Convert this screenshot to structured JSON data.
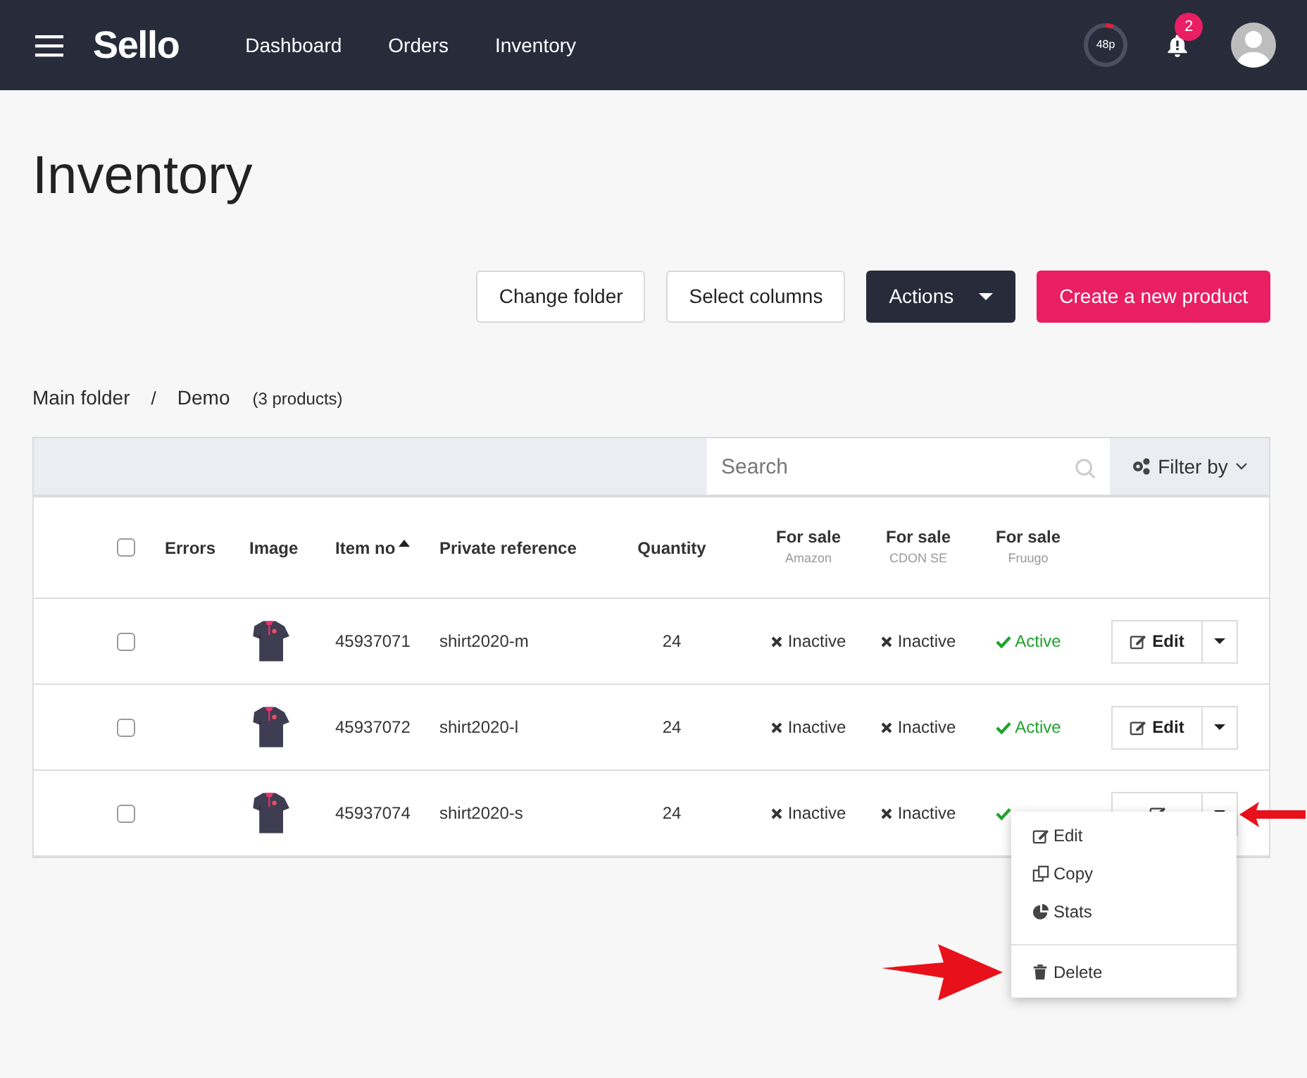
{
  "nav": {
    "logo": "Sello",
    "links": [
      {
        "label": "Dashboard"
      },
      {
        "label": "Orders"
      },
      {
        "label": "Inventory"
      }
    ],
    "meter": {
      "label": "48p",
      "level": 0.06
    },
    "notifications": "2"
  },
  "page_title": "Inventory",
  "buttons": [
    {
      "label": "Change folder",
      "kind": "outline"
    },
    {
      "label": "Select columns",
      "kind": "outline"
    },
    {
      "label": "Actions",
      "kind": "dark"
    },
    {
      "label": "Create a new product",
      "kind": "primary"
    }
  ],
  "breadcrumb": {
    "items": [
      "Main folder",
      "Demo"
    ],
    "separator": "/",
    "count": "(3 products)"
  },
  "search": {
    "placeholder": "Search"
  },
  "filter": {
    "label": "Filter by"
  },
  "table": {
    "select_all": {
      "checked": false
    },
    "columns": [
      {
        "label": "Errors"
      },
      {
        "label": "Image"
      },
      {
        "label": "Item no",
        "sorted": true
      },
      {
        "label": "Private reference"
      },
      {
        "label": "Quantity"
      },
      {
        "label": "For sale",
        "sub": "Amazon"
      },
      {
        "label": "For sale",
        "sub": "CDON SE"
      },
      {
        "label": "For sale",
        "sub": "Fruugo"
      }
    ],
    "rows": [
      {
        "checked": false,
        "item_no": "45937071",
        "reference": "shirt2020-m",
        "quantity": "24",
        "statuses": [
          {
            "label": "Inactive",
            "active": false
          },
          {
            "label": "Inactive",
            "active": false
          },
          {
            "label": "Active",
            "active": true
          }
        ],
        "edit": "Edit",
        "menu_open": false
      },
      {
        "checked": false,
        "item_no": "45937072",
        "reference": "shirt2020-l",
        "quantity": "24",
        "statuses": [
          {
            "label": "Inactive",
            "active": false
          },
          {
            "label": "Inactive",
            "active": false
          },
          {
            "label": "Active",
            "active": true
          }
        ],
        "edit": "Edit",
        "menu_open": false
      },
      {
        "checked": false,
        "item_no": "45937074",
        "reference": "shirt2020-s",
        "quantity": "24",
        "statuses": [
          {
            "label": "Inactive",
            "active": false
          },
          {
            "label": "Inactive",
            "active": false
          },
          {
            "active": true
          }
        ],
        "menu_open": true
      }
    ]
  },
  "row_menu": {
    "items": [
      {
        "label": "Edit",
        "kind": "edit"
      },
      {
        "label": "Copy",
        "kind": "copy"
      },
      {
        "label": "Stats",
        "kind": "stats"
      },
      {
        "label": "Delete",
        "kind": "delete"
      }
    ]
  }
}
